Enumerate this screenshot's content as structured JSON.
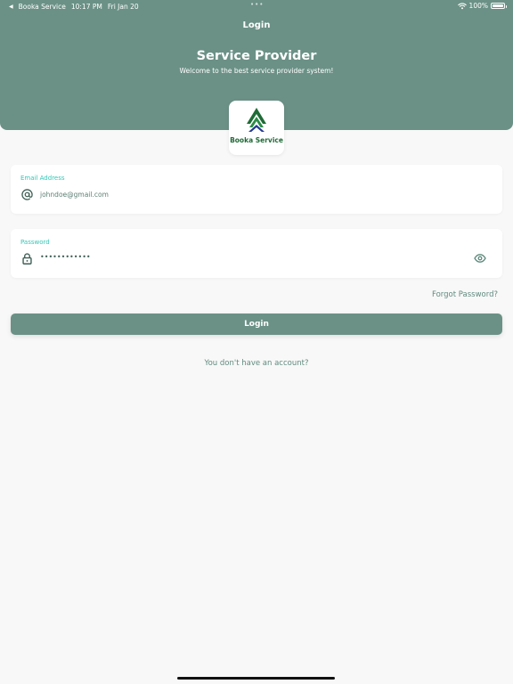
{
  "status_bar": {
    "back_app": "Booka Service",
    "time": "10:17 PM",
    "date": "Fri Jan 20",
    "battery": "100%",
    "battery_level": 1.0,
    "icons": {
      "back": "back-arrow-icon",
      "wifi": "wifi-icon",
      "battery": "battery-icon"
    }
  },
  "header": {
    "nav_title": "Login",
    "title": "Service Provider",
    "subtitle": "Welcome to the best service provider system!"
  },
  "logo": {
    "text": "Booka Service",
    "icon": "booka-leaf-logo"
  },
  "form": {
    "email": {
      "label": "Email Address",
      "value": "johndoe@gmail.com",
      "icon": "at-sign-icon"
    },
    "password": {
      "label": "Password",
      "masked_value": "••••••••••••",
      "icon": "lock-icon",
      "toggle_icon": "eye-icon"
    },
    "forgot_password": "Forgot Password?",
    "login_button": "Login",
    "signup_prompt": "You don't have an account?"
  },
  "colors": {
    "primary": "#6b9186",
    "accent_label": "#33c6b6",
    "background": "#f8f8f8",
    "logo_green": "#1f6b36",
    "logo_blue": "#233a8f"
  }
}
